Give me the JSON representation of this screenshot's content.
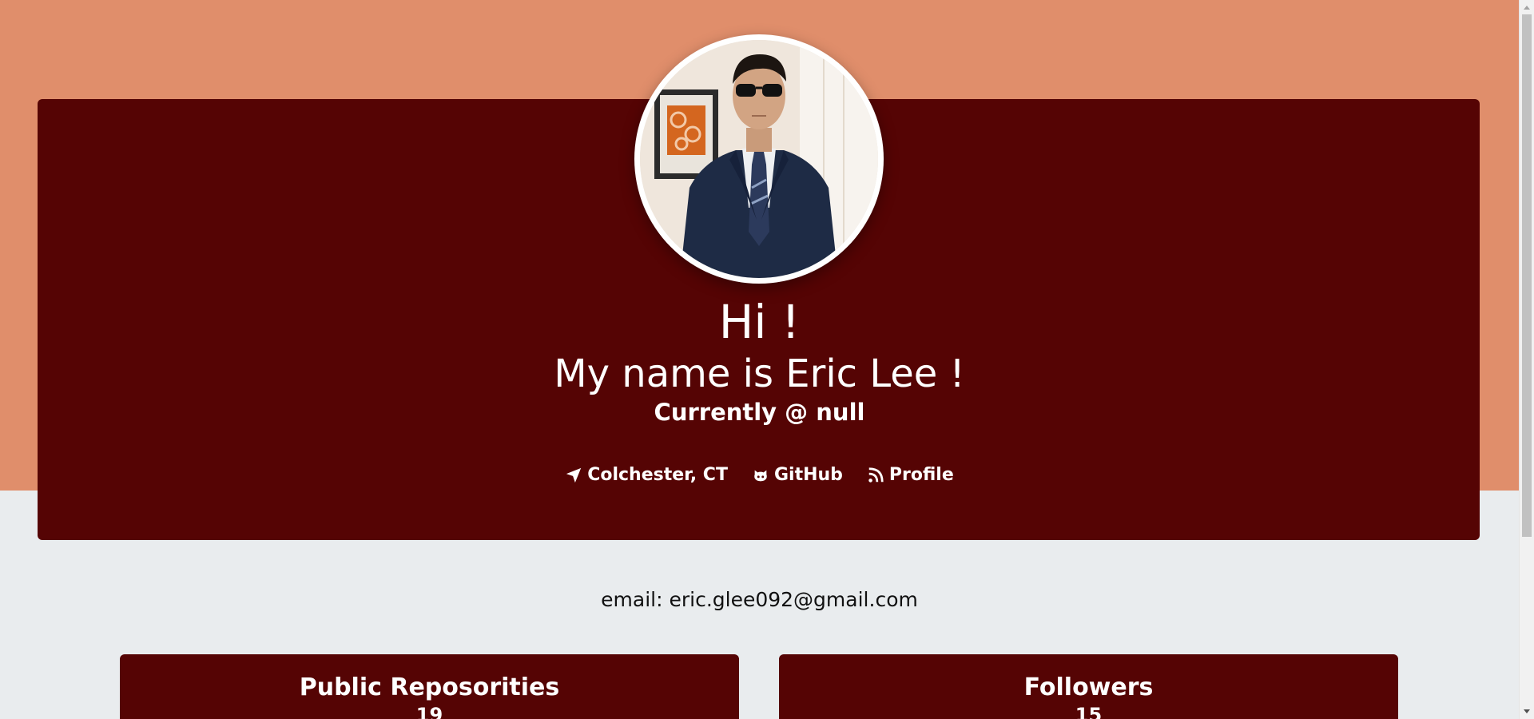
{
  "hero": {
    "greeting": "Hi !",
    "name_line": "My name is Eric Lee !",
    "currently": "Currently @ null",
    "avatar_alt": "profile photo of Eric Lee"
  },
  "links": [
    {
      "label": "Colchester, CT",
      "icon": "location-arrow-icon"
    },
    {
      "label": "GitHub",
      "icon": "github-icon"
    },
    {
      "label": "Profile",
      "icon": "rss-icon"
    }
  ],
  "contact": {
    "email_line": "email: eric.glee092@gmail.com"
  },
  "stats": [
    {
      "title": "Public Reposorities",
      "value": "19"
    },
    {
      "title": "Followers",
      "value": "15"
    }
  ],
  "colors": {
    "band": "#e08e6b",
    "card": "#550404",
    "background": "#e9ecee"
  }
}
